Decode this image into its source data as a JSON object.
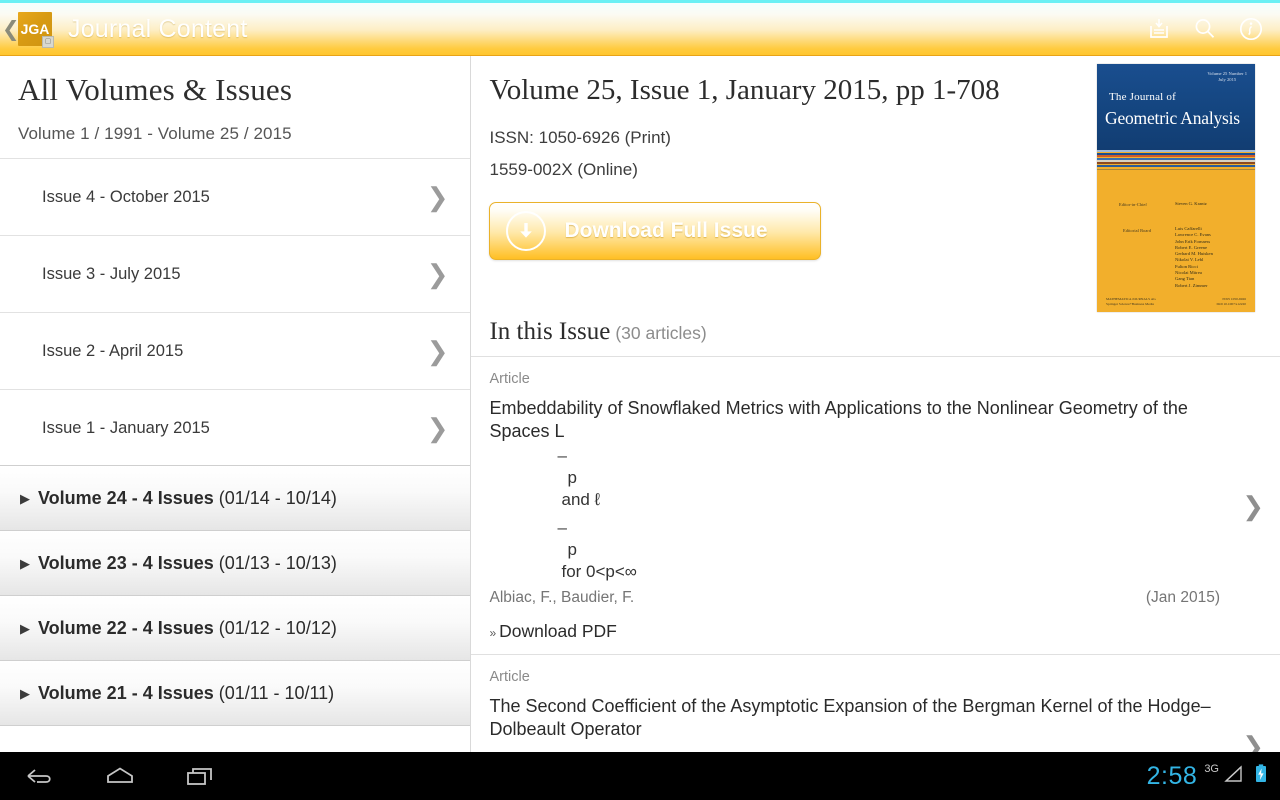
{
  "appbar": {
    "back_icon": "back-chevron-icon",
    "logo_text": "JGA",
    "logo_sub_icon": "journal-badge-icon",
    "title": "Journal Content",
    "actions": [
      {
        "name": "print-icon",
        "label": "Print"
      },
      {
        "name": "search-icon",
        "label": "Search"
      },
      {
        "name": "info-icon",
        "label": "Info"
      }
    ],
    "accent_top": "#69f0f4",
    "accent_bottom": "#ffc62e"
  },
  "sidebar": {
    "title": "All Volumes & Issues",
    "range": "Volume 1 / 1991 - Volume 25 / 2015",
    "issues": [
      {
        "label": "Issue 4 - October 2015"
      },
      {
        "label": "Issue 3 - July 2015"
      },
      {
        "label": "Issue 2 - April 2015"
      },
      {
        "label": "Issue 1 - January 2015"
      }
    ],
    "volumes": [
      {
        "main": "Volume 24 - 4 Issues",
        "dates": "(01/14 - 10/14)"
      },
      {
        "main": "Volume 23 - 4 Issues",
        "dates": "(01/13 - 10/13)"
      },
      {
        "main": "Volume 22 - 4 Issues",
        "dates": "(01/12 - 10/12)"
      },
      {
        "main": "Volume 21 - 4 Issues",
        "dates": "(01/11 - 10/11)"
      }
    ]
  },
  "issue": {
    "title": "Volume 25, Issue 1, January 2015, pp 1-708",
    "issn_print": "ISSN: 1050-6926 (Print)",
    "issn_online": "1559-002X (Online)",
    "download_label": "Download Full Issue",
    "download_icon": "download-circle-icon"
  },
  "cover": {
    "volume_info": "Volume 25 Number 1\nJuly 2015",
    "the_journal_of": "The Journal of",
    "journal_name": "Geometric Analysis",
    "editor_in_chief_label": "Editor-in-Chief",
    "editor_in_chief": "Steven G. Krantz",
    "editorial_board_label": "Editorial Board",
    "editors": [
      "Luis Caffarelli",
      "Lawrence C. Evans",
      "John Erik Fornaess",
      "Robert E. Greene",
      "Gerhard M. Huisken",
      "Nikolai V. Lebl",
      "Fulton Ricci",
      "Nicolai Mitrea",
      "Gang Tian",
      "Robert J. Zimmer"
    ],
    "footer_left": "MATHEMATICA JOURNALS AG\nSpringer Science+Business Media",
    "footer_right": "ISSN 1050-6926\nDOI 10.1007/s12220"
  },
  "in_this_issue": {
    "title": "In this Issue",
    "count": "(30 articles)"
  },
  "articles": [
    {
      "type": "Article",
      "title": "Embeddability of Snowflaked Metrics with Applications to the Nonlinear Geometry of the Spaces L",
      "math_line1_dash": "–",
      "math_line1_sub": "p",
      "math_line2": "and ℓ",
      "math_line3_dash": "–",
      "math_line3_sub": "p",
      "math_line4": "for 0<p<∞",
      "authors": "Albiac, F., Baudier, F.",
      "date": "(Jan 2015)",
      "pdf_label": "Download PDF",
      "pdf_chevron": "»"
    },
    {
      "type": "Article",
      "title": "The Second Coefficient of the Asymptotic Expansion of the Bergman Kernel of the Hodge–Dolbeault Operator"
    }
  ],
  "navbar": {
    "buttons": [
      {
        "name": "nav-back-icon"
      },
      {
        "name": "nav-home-icon"
      },
      {
        "name": "nav-recents-icon"
      }
    ],
    "clock": "2:58",
    "signal_label": "3G",
    "signal_icon": "signal-triangle-icon",
    "battery_icon": "battery-charging-icon",
    "clock_color": "#33b5e5"
  }
}
